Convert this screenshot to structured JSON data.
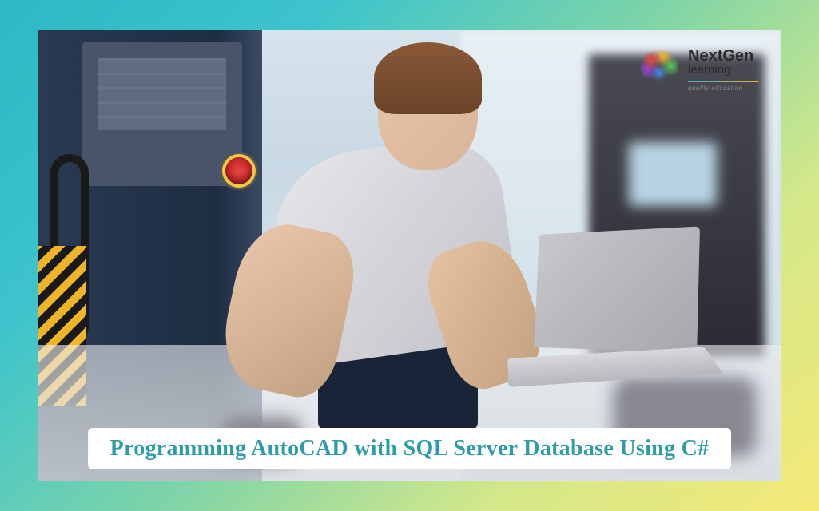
{
  "logo": {
    "brand_primary": "NextGen",
    "brand_secondary": "learning",
    "tagline": "quality education"
  },
  "banner": {
    "title": "Programming AutoCAD with SQL Server Database Using C#"
  },
  "colors": {
    "frame_teal": "#2db8c4",
    "frame_yellow": "#f4e976",
    "title_color": "#2d9ba8"
  }
}
